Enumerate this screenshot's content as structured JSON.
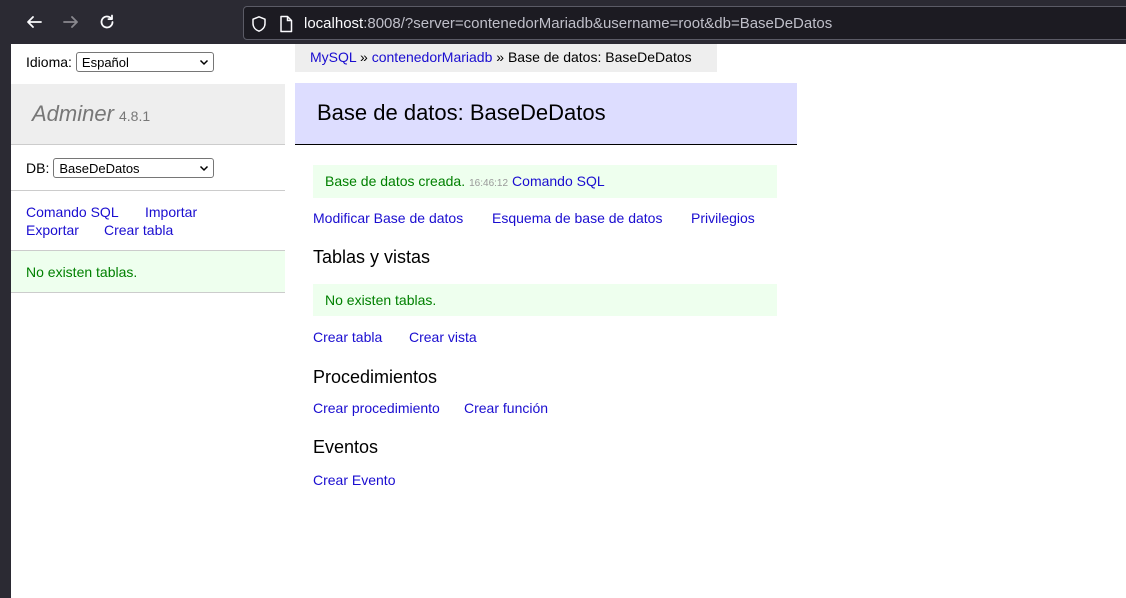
{
  "browser": {
    "back_icon": "arrow-left-icon",
    "forward_icon": "arrow-right-icon",
    "reload_icon": "reload-icon",
    "url_host": "localhost",
    "url_rest": ":8008/?server=contenedorMariadb&username=root&db=BaseDeDatos"
  },
  "sidebar": {
    "language_label": "Idioma:",
    "language_value": "Español",
    "app_name": "Adminer",
    "app_version": "4.8.1",
    "db_label": "DB:",
    "db_value": "BaseDeDatos",
    "links": [
      "Comando SQL",
      "Importar",
      "Exportar",
      "Crear tabla"
    ],
    "no_tables": "No existen tablas."
  },
  "breadcrumb": {
    "item1": "MySQL",
    "sep": " » ",
    "item2": "contenedorMariadb",
    "current": "Base de datos: BaseDeDatos"
  },
  "main": {
    "title": "Base de datos: BaseDeDatos",
    "success_message": "Base de datos creada.",
    "success_time": "16:46:12",
    "success_link": "Comando SQL",
    "db_actions": [
      "Modificar Base de datos",
      "Esquema de base de datos",
      "Privilegios"
    ],
    "tables_heading": "Tablas y vistas",
    "tables_empty": "No existen tablas.",
    "table_actions": [
      "Crear tabla",
      "Crear vista"
    ],
    "procedures_heading": "Procedimientos",
    "procedure_actions": [
      "Crear procedimiento",
      "Crear función"
    ],
    "events_heading": "Eventos",
    "event_actions": [
      "Crear Evento"
    ]
  },
  "colors": {
    "link": "#1a0dd0",
    "success_text": "#008000",
    "success_bg": "#eeffee",
    "title_bg": "#ddddff"
  }
}
